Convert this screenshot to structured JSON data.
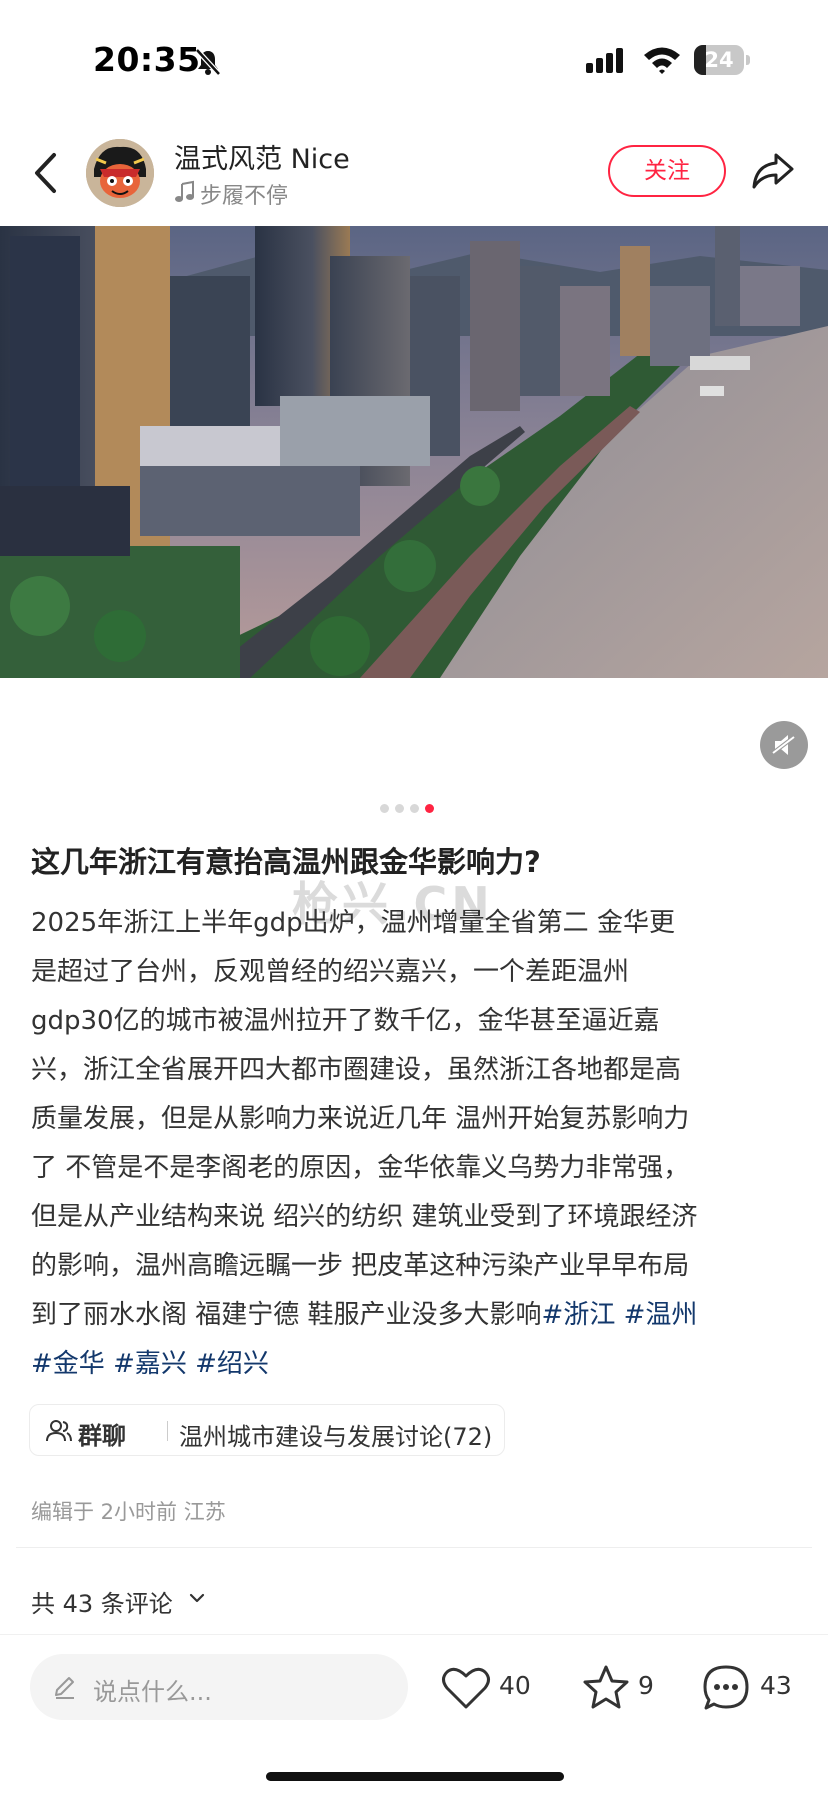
{
  "status_bar": {
    "time": "20:35",
    "battery": "24",
    "battery_level_percent": 24
  },
  "header": {
    "author_name": "温式风范 Nice",
    "author_song": "步履不停",
    "follow_label": "关注"
  },
  "carousel": {
    "total_pages": 4,
    "active_page": 4
  },
  "post": {
    "title": "这几年浙江有意抬高温州跟金华影响力?",
    "body_lines": [
      "2025年浙江上半年gdp出炉，温州增量全省第二 金华更",
      "是超过了台州，反观曾经的绍兴嘉兴，一个差距温州",
      "gdp30亿的城市被温州拉开了数千亿，金华甚至逼近嘉",
      "兴，浙江全省展开四大都市圈建设，虽然浙江各地都是高",
      "质量发展，但是从影响力来说近几年 温州开始复苏影响力",
      "了 不管是不是李阁老的原因，金华依靠义乌势力非常强，",
      "但是从产业结构来说 绍兴的纺织 建筑业受到了环境跟经济",
      "的影响，温州高瞻远瞩一步 把皮革这种污染产业早早布局",
      "到了丽水水阁 福建宁德 鞋服产业没多大影响"
    ],
    "tags_inline": [
      "#浙江",
      "#温州"
    ],
    "tags_next_line": [
      "#金华",
      "#嘉兴",
      "#绍兴"
    ],
    "watermark": "枪兴.CN"
  },
  "group_chat": {
    "label": "群聊",
    "name": "温州城市建设与发展讨论(72)"
  },
  "meta": {
    "edited": "编辑于 2小时前 江苏"
  },
  "comments": {
    "count_label": "共 43 条评论"
  },
  "bottom_bar": {
    "input_placeholder": "说点什么...",
    "likes": "40",
    "collects": "9",
    "comments": "43"
  },
  "colors": {
    "accent": "#ff2442",
    "tag": "#13386c"
  },
  "icons": [
    "bell-slash-icon",
    "signal-icon",
    "wifi-icon",
    "back-icon",
    "music-icon",
    "share-icon",
    "sound-icon",
    "group-icon",
    "chevron-down-icon",
    "pencil-icon",
    "heart-icon",
    "star-icon",
    "comment-icon"
  ]
}
